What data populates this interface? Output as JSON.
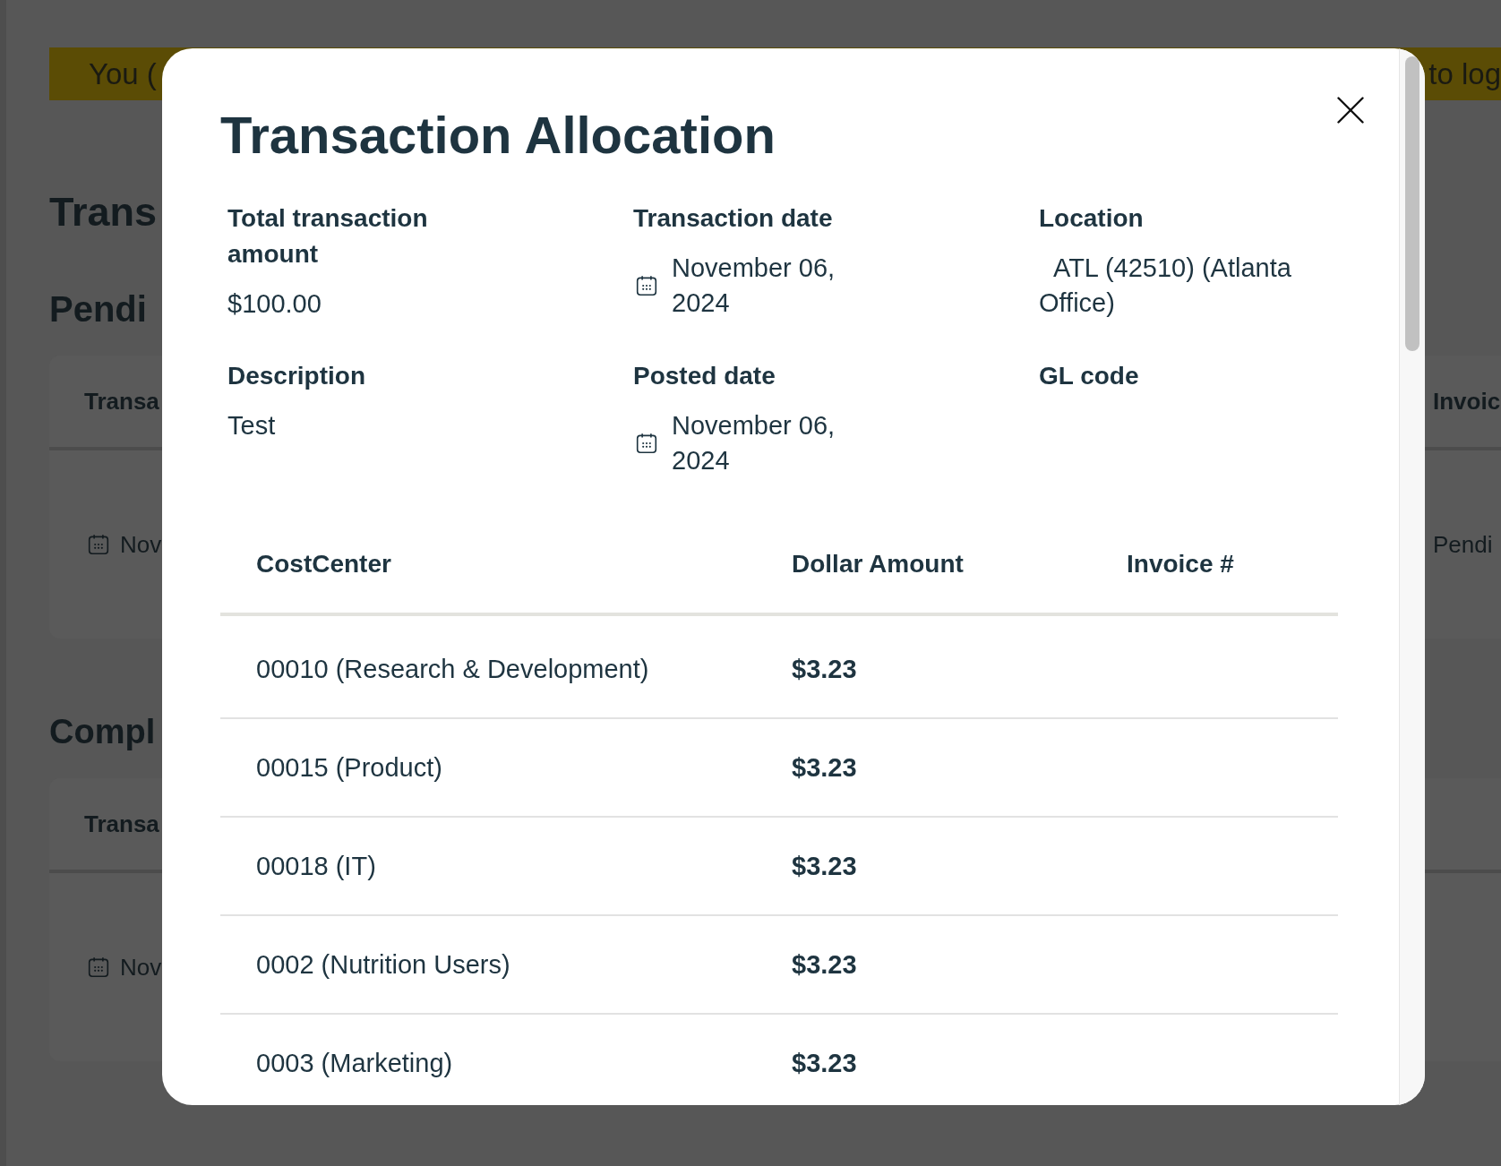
{
  "background_page": {
    "banner": {
      "left_text": "You (",
      "right_text": "to log"
    },
    "heading": "Trans",
    "sections": [
      {
        "title": "Pendi",
        "table": {
          "columns": [
            "Transa",
            "Invoic"
          ],
          "rows": [
            {
              "cells": [
                {
                  "kind": "date",
                  "text": "Nov"
                },
                {
                  "kind": "text",
                  "text": "Pendi"
                }
              ]
            }
          ]
        }
      },
      {
        "title": "Compl",
        "table": {
          "columns": [
            "Transa"
          ],
          "rows": [
            {
              "cells": [
                {
                  "kind": "date",
                  "text": "Nov"
                }
              ]
            }
          ]
        }
      }
    ]
  },
  "modal": {
    "title": "Transaction Allocation",
    "fields": [
      {
        "kind": "text",
        "label": "Total transaction amount",
        "value": "$100.00"
      },
      {
        "kind": "date",
        "label": "Transaction date",
        "value": "November 06, 2024"
      },
      {
        "kind": "location",
        "label": "Location",
        "value": "ATL (42510) (Atlanta Office)"
      },
      {
        "kind": "text",
        "label": "Description",
        "value": "Test"
      },
      {
        "kind": "date",
        "label": "Posted date",
        "value": "November 06, 2024"
      },
      {
        "kind": "text",
        "label": "GL code"
      }
    ],
    "table": {
      "columns": [
        "CostCenter",
        "Dollar Amount",
        "Invoice #"
      ],
      "rows": [
        {
          "cost_center": "00010 (Research & Development)",
          "dollar_amount": "$3.23"
        },
        {
          "cost_center": "00015 (Product)",
          "dollar_amount": "$3.23"
        },
        {
          "cost_center": "00018 (IT)",
          "dollar_amount": "$3.23"
        },
        {
          "cost_center": "0002 (Nutrition Users)",
          "dollar_amount": "$3.23"
        },
        {
          "cost_center": "0003 (Marketing)",
          "dollar_amount": "$3.23"
        }
      ]
    }
  }
}
